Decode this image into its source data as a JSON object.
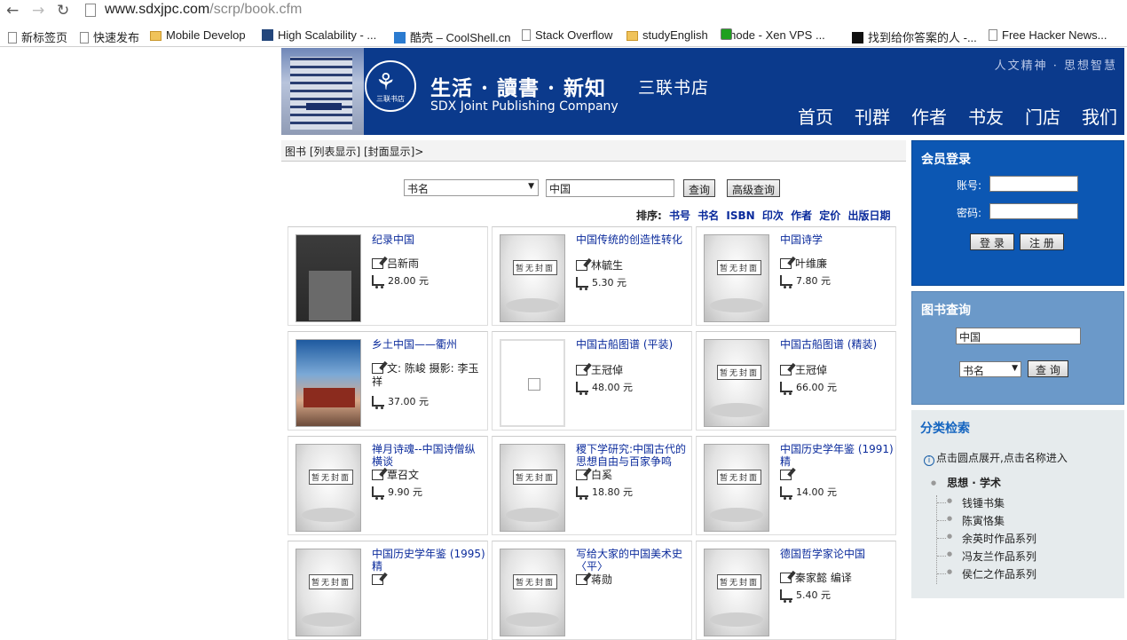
{
  "browser": {
    "url_host": "www.sdxjpc.com",
    "url_path": "/scrp/book.cfm",
    "bookmarks": [
      {
        "label": "新标签页",
        "icon": "page-icon"
      },
      {
        "label": "快速发布",
        "icon": "page-icon"
      },
      {
        "label": "Mobile Develop",
        "icon": "folder-icon"
      },
      {
        "label": "High Scalability - ...",
        "icon": "hs-icon"
      },
      {
        "label": "酷壳 – CoolShell.cn",
        "icon": "coolshell-icon"
      },
      {
        "label": "Stack Overflow",
        "icon": "page-icon"
      },
      {
        "label": "studyEnglish",
        "icon": "folder-icon"
      },
      {
        "label": "Linode - Xen VPS ...",
        "icon": "linode-icon"
      },
      {
        "label": "找到给你答案的人 -...",
        "icon": "42-icon"
      },
      {
        "label": "Free Hacker News...",
        "icon": "page-icon"
      }
    ]
  },
  "header": {
    "slogan": "生活 · 讀書 · 新知",
    "brand": "三联书店",
    "brand_en": "SDX Joint Publishing Company",
    "motto": "人文精神 · 思想智慧",
    "logo_text": "三联书店",
    "nav": [
      "首页",
      "刊群",
      "作者",
      "书友",
      "门店",
      "我们"
    ]
  },
  "breadcrumb": "图书 [列表显示] [封面显示]>",
  "search": {
    "field": "书名",
    "query": "中国",
    "query_button": "查询",
    "advanced_button": "高级查询"
  },
  "sort": {
    "label": "排序:",
    "options": [
      "书号",
      "书名",
      "ISBN",
      "印次",
      "作者",
      "定价",
      "出版日期"
    ]
  },
  "books": [
    {
      "title": "纪录中国",
      "author": "吕新雨",
      "price": "28.00 元",
      "cover": "rec"
    },
    {
      "title": "中国传统的创造性转化",
      "author": "林毓生",
      "price": "5.30 元",
      "cover": "gray"
    },
    {
      "title": "中国诗学",
      "author": "叶维廉",
      "price": "7.80 元",
      "cover": "gray"
    },
    {
      "title": "乡土中国——衢州",
      "author": "文: 陈峻 摄影: 李玉祥",
      "price": "37.00 元",
      "cover": "quzhou"
    },
    {
      "title": "中国古船图谱 (平装)",
      "author": "王冠倬",
      "price": "48.00 元",
      "cover": "blank"
    },
    {
      "title": "中国古船图谱 (精装)",
      "author": "王冠倬",
      "price": "66.00 元",
      "cover": "gray"
    },
    {
      "title": "禅月诗魂--中国诗僧纵横谈",
      "author": "覃召文",
      "price": "9.90 元",
      "cover": "gray"
    },
    {
      "title": "稷下学研究:中国古代的思想自由与百家争鸣",
      "author": "白奚",
      "price": "18.80 元",
      "cover": "gray"
    },
    {
      "title": "中国历史学年鉴 (1991) 精",
      "author": "",
      "price": "14.00 元",
      "cover": "gray"
    },
    {
      "title": "中国历史学年鉴 (1995) 精",
      "author": "",
      "price": "",
      "cover": "gray"
    },
    {
      "title": "写给大家的中国美术史 〈平〉",
      "author": "蒋勋",
      "price": "",
      "cover": "gray"
    },
    {
      "title": "德国哲学家论中国",
      "author": "秦家懿 编译",
      "price": "5.40 元",
      "cover": "gray"
    }
  ],
  "cover_placeholder_text": "暂无封面",
  "login": {
    "title": "会员登录",
    "account_label": "账号:",
    "password_label": "密码:",
    "login_button": "登 录",
    "register_button": "注 册"
  },
  "side_search": {
    "title": "图书查询",
    "query": "中国",
    "field": "书名",
    "button": "查 询"
  },
  "categories": {
    "title": "分类检索",
    "hint": "点击圆点展开,点击名称进入",
    "root": "思想 · 学术",
    "items": [
      "钱锺书集",
      "陈寅恪集",
      "余英时作品系列",
      "冯友兰作品系列",
      "侯仁之作品系列"
    ]
  },
  "colors": {
    "header_bg": "#0b3a8c",
    "login_bg": "#0c57b3",
    "search_bg": "#6b99c9",
    "link": "#0b2b9c"
  }
}
